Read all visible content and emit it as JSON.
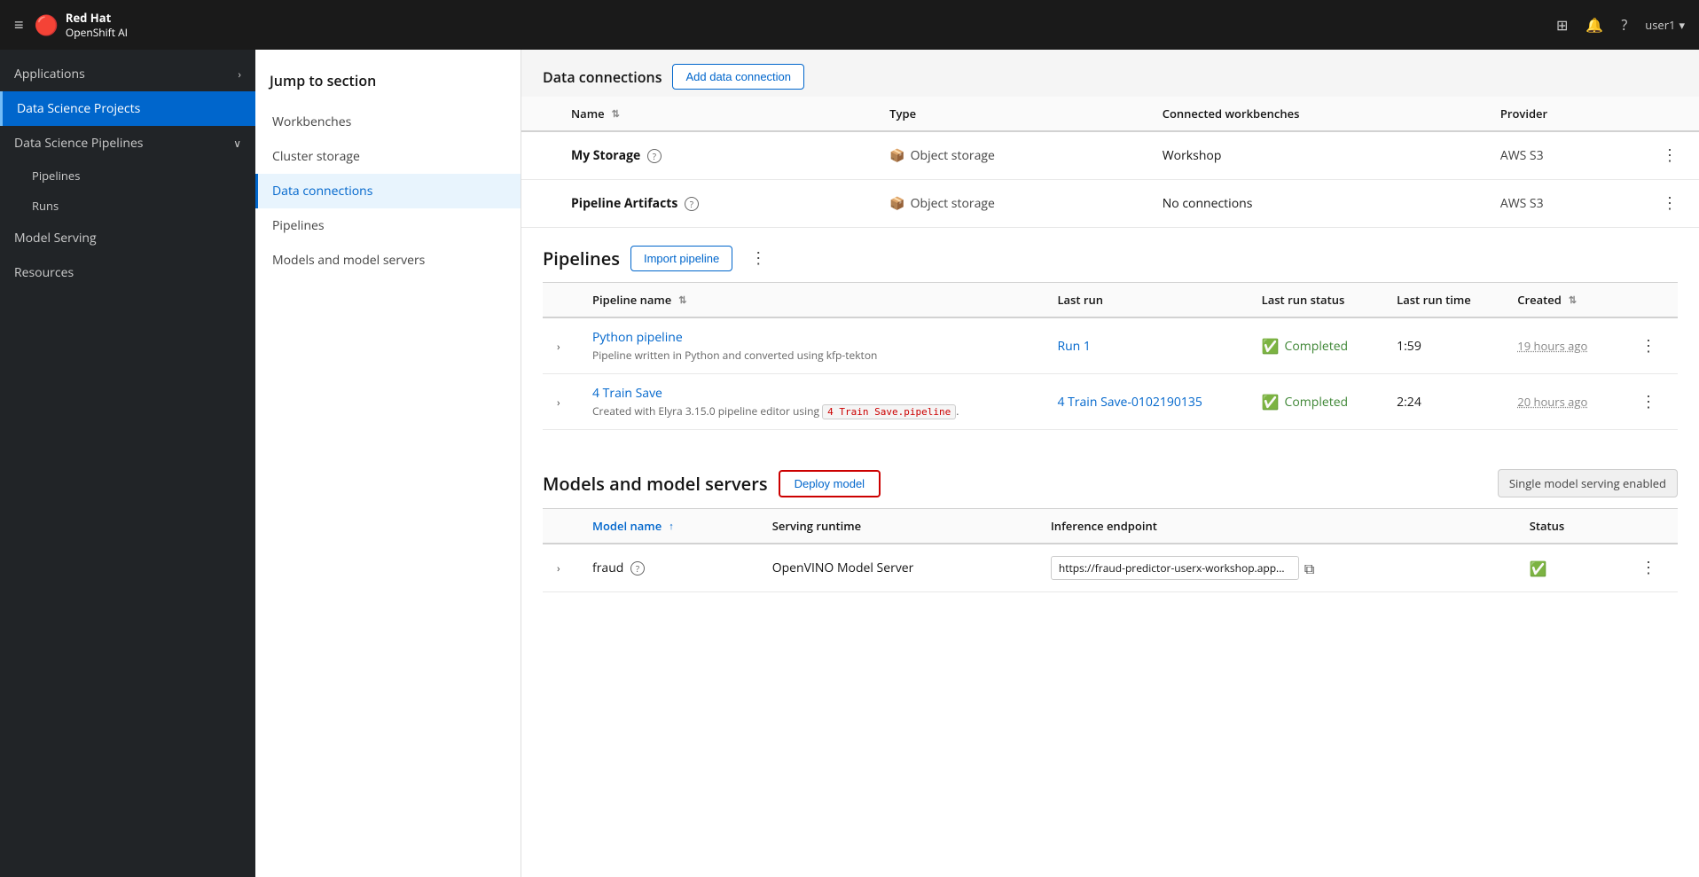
{
  "topnav": {
    "brand_line1": "Red Hat",
    "brand_line2": "OpenShift AI",
    "user": "user1",
    "hamburger": "≡",
    "grid_icon": "⊞",
    "bell_icon": "🔔",
    "help_icon": "?"
  },
  "sidebar": {
    "items": [
      {
        "id": "applications",
        "label": "Applications",
        "has_chevron": true,
        "active": false
      },
      {
        "id": "data-science-projects",
        "label": "Data Science Projects",
        "has_chevron": false,
        "active": true
      },
      {
        "id": "data-science-pipelines",
        "label": "Data Science Pipelines",
        "has_chevron": true,
        "active": false
      },
      {
        "id": "pipelines-sub",
        "label": "Pipelines",
        "sub": true
      },
      {
        "id": "runs-sub",
        "label": "Runs",
        "sub": true
      },
      {
        "id": "model-serving",
        "label": "Model Serving",
        "has_chevron": false,
        "active": false
      },
      {
        "id": "resources",
        "label": "Resources",
        "has_chevron": false,
        "active": false
      }
    ]
  },
  "jump_section": {
    "title": "Jump to section",
    "items": [
      {
        "id": "workbenches",
        "label": "Workbenches",
        "active": false
      },
      {
        "id": "cluster-storage",
        "label": "Cluster storage",
        "active": false
      },
      {
        "id": "data-connections",
        "label": "Data connections",
        "active": true
      },
      {
        "id": "pipelines",
        "label": "Pipelines",
        "active": false
      },
      {
        "id": "models-servers",
        "label": "Models and model servers",
        "active": false
      }
    ]
  },
  "data_connections": {
    "section_title": "Data connections",
    "add_button": "Add data connection",
    "columns": {
      "name": "Name",
      "type": "Type",
      "connected_workbenches": "Connected workbenches",
      "provider": "Provider"
    },
    "rows": [
      {
        "name": "My Storage",
        "has_help": true,
        "type": "Object storage",
        "workbenches": "Workshop",
        "provider": "AWS S3"
      },
      {
        "name": "Pipeline Artifacts",
        "has_help": true,
        "type": "Object storage",
        "workbenches": "No connections",
        "provider": "AWS S3"
      }
    ]
  },
  "pipelines": {
    "section_title": "Pipelines",
    "import_button": "Import pipeline",
    "columns": {
      "pipeline_name": "Pipeline name",
      "last_run": "Last run",
      "last_run_status": "Last run status",
      "last_run_time": "Last run time",
      "created": "Created"
    },
    "rows": [
      {
        "name": "Python pipeline",
        "description": "Pipeline written in Python and converted using kfp-tekton",
        "last_run": "Run 1",
        "status": "Completed",
        "run_time": "1:59",
        "created": "19 hours ago"
      },
      {
        "name": "4 Train Save",
        "description_prefix": "Created with Elyra 3.15.0 pipeline editor using ",
        "description_tag": "4 Train Save.pipeline",
        "description_suffix": ".",
        "last_run": "4 Train Save-0102190135",
        "status": "Completed",
        "run_time": "2:24",
        "created": "20 hours ago"
      }
    ]
  },
  "models": {
    "section_title": "Models and model servers",
    "deploy_button": "Deploy model",
    "serving_badge": "Single model serving enabled",
    "columns": {
      "model_name": "Model name",
      "serving_runtime": "Serving runtime",
      "inference_endpoint": "Inference endpoint",
      "status": "Status"
    },
    "rows": [
      {
        "name": "fraud",
        "has_help": true,
        "serving_runtime": "OpenVINO Model Server",
        "inference_endpoint": "https://fraud-predictor-userx-workshop.app...",
        "status": "success"
      }
    ]
  }
}
